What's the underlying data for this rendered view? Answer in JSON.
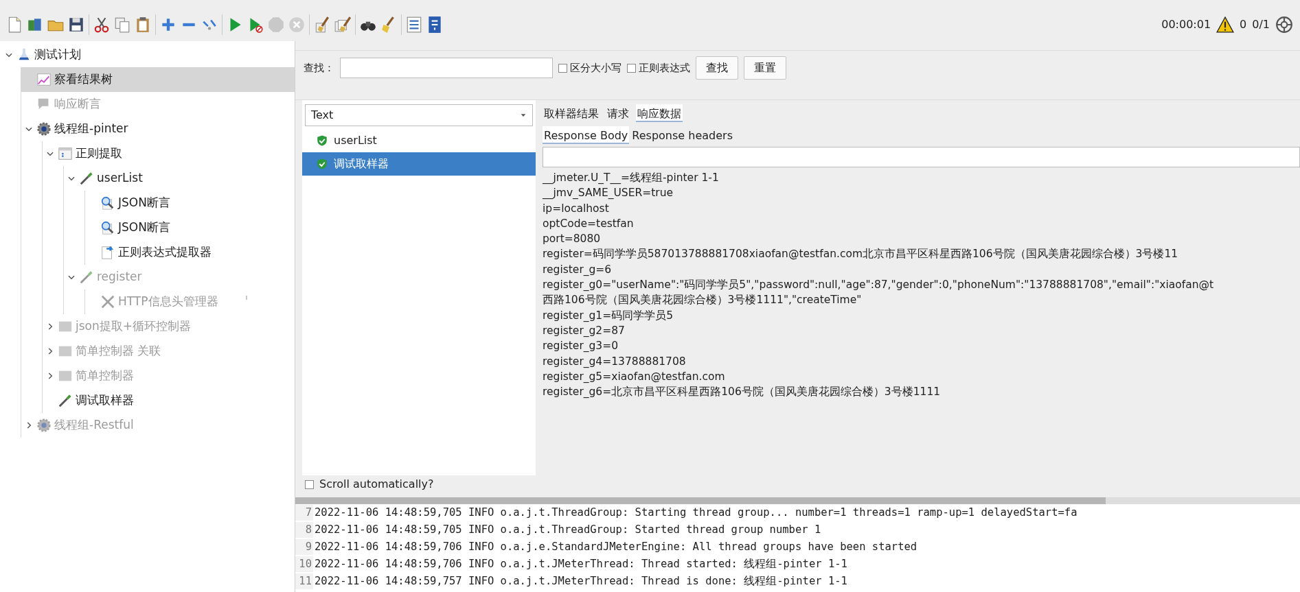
{
  "toolbar": {
    "elapsed": "00:00:01",
    "warnings": "0",
    "threads": "0/1"
  },
  "tree": [
    {
      "label": "测试计划",
      "kind": "plan",
      "selected": false,
      "disabled": false,
      "expanded": true,
      "children": [
        {
          "label": "察看结果树",
          "kind": "listener",
          "selected": true,
          "disabled": false
        },
        {
          "label": "响应断言",
          "kind": "assertion",
          "selected": false,
          "disabled": true
        },
        {
          "label": "线程组-pinter",
          "kind": "threadgroup",
          "selected": false,
          "disabled": false,
          "expanded": true,
          "children": [
            {
              "label": "正则提取",
              "kind": "controller",
              "selected": false,
              "disabled": false,
              "expanded": true,
              "children": [
                {
                  "label": "userList",
                  "kind": "sampler",
                  "selected": false,
                  "disabled": false,
                  "expanded": true,
                  "children": [
                    {
                      "label": "JSON断言",
                      "kind": "magnifier",
                      "selected": false,
                      "disabled": false
                    },
                    {
                      "label": "JSON断言",
                      "kind": "magnifier",
                      "selected": false,
                      "disabled": false
                    },
                    {
                      "label": "正则表达式提取器",
                      "kind": "extractor",
                      "selected": false,
                      "disabled": false
                    }
                  ]
                },
                {
                  "label": "register",
                  "kind": "sampler",
                  "selected": false,
                  "disabled": true,
                  "expanded": true,
                  "children": [
                    {
                      "label": "HTTP信息头管理器",
                      "kind": "tools",
                      "selected": false,
                      "disabled": true
                    }
                  ]
                }
              ]
            },
            {
              "label": "json提取+循环控制器",
              "kind": "block",
              "selected": false,
              "disabled": true,
              "expanded": false
            },
            {
              "label": "简单控制器 关联",
              "kind": "block",
              "selected": false,
              "disabled": true,
              "expanded": false
            },
            {
              "label": "简单控制器",
              "kind": "block",
              "selected": false,
              "disabled": true,
              "expanded": false
            },
            {
              "label": "调试取样器",
              "kind": "sampler",
              "selected": false,
              "disabled": false
            }
          ]
        },
        {
          "label": "线程组-Restful",
          "kind": "threadgroup",
          "selected": false,
          "disabled": true,
          "expanded": false
        }
      ]
    }
  ],
  "search": {
    "label": "查找：",
    "options": [
      {
        "label": "区分大小写",
        "checked": false
      },
      {
        "label": "正则表达式",
        "checked": false
      }
    ],
    "buttons": [
      "查找",
      "重置"
    ]
  },
  "results": {
    "renderer": "Text",
    "samples": [
      {
        "label": "userList",
        "selected": false
      },
      {
        "label": "调试取样器",
        "selected": true
      }
    ],
    "scroll_auto": {
      "label": "Scroll automatically?",
      "checked": false
    }
  },
  "tabs": [
    {
      "label": "取样器结果",
      "selected": false
    },
    {
      "label": "请求",
      "selected": false
    },
    {
      "label": "响应数据",
      "selected": true
    }
  ],
  "subtabs": [
    {
      "label": "Response Body",
      "selected": true
    },
    {
      "label": "Response headers",
      "selected": false
    }
  ],
  "response_lines": [
    "__jmeter.U_T__=线程组-pinter 1-1",
    "__jmv_SAME_USER=true",
    "ip=localhost",
    "optCode=testfan",
    "port=8080",
    "register=码同学学员587013788881708xiaofan@testfan.com北京市昌平区科星西路106号院（国风美唐花园综合楼）3号楼11",
    "register_g=6",
    "register_g0=\"userName\":\"码同学学员5\",\"password\":null,\"age\":87,\"gender\":0,\"phoneNum\":\"13788881708\",\"email\":\"xiaofan@t",
    "西路106号院（国风美唐花园综合楼）3号楼1111\",\"createTime\"",
    "register_g1=码同学学员5",
    "register_g2=87",
    "register_g3=0",
    "register_g4=13788881708",
    "register_g5=xiaofan@testfan.com",
    "register_g6=北京市昌平区科星西路106号院（国风美唐花园综合楼）3号楼1111"
  ],
  "log": [
    {
      "number": "7",
      "text": "2022-11-06 14:48:59,705 INFO o.a.j.t.ThreadGroup: Starting thread group... number=1 threads=1 ramp-up=1 delayedStart=fa"
    },
    {
      "number": "8",
      "text": "2022-11-06 14:48:59,705 INFO o.a.j.t.ThreadGroup: Started thread group number 1"
    },
    {
      "number": "9",
      "text": "2022-11-06 14:48:59,706 INFO o.a.j.e.StandardJMeterEngine: All thread groups have been started"
    },
    {
      "number": "10",
      "text": "2022-11-06 14:48:59,706 INFO o.a.j.t.JMeterThread: Thread started: 线程组-pinter 1-1"
    },
    {
      "number": "11",
      "text": "2022-11-06 14:48:59,757 INFO o.a.j.t.JMeterThread: Thread is done: 线程组-pinter 1-1"
    }
  ]
}
